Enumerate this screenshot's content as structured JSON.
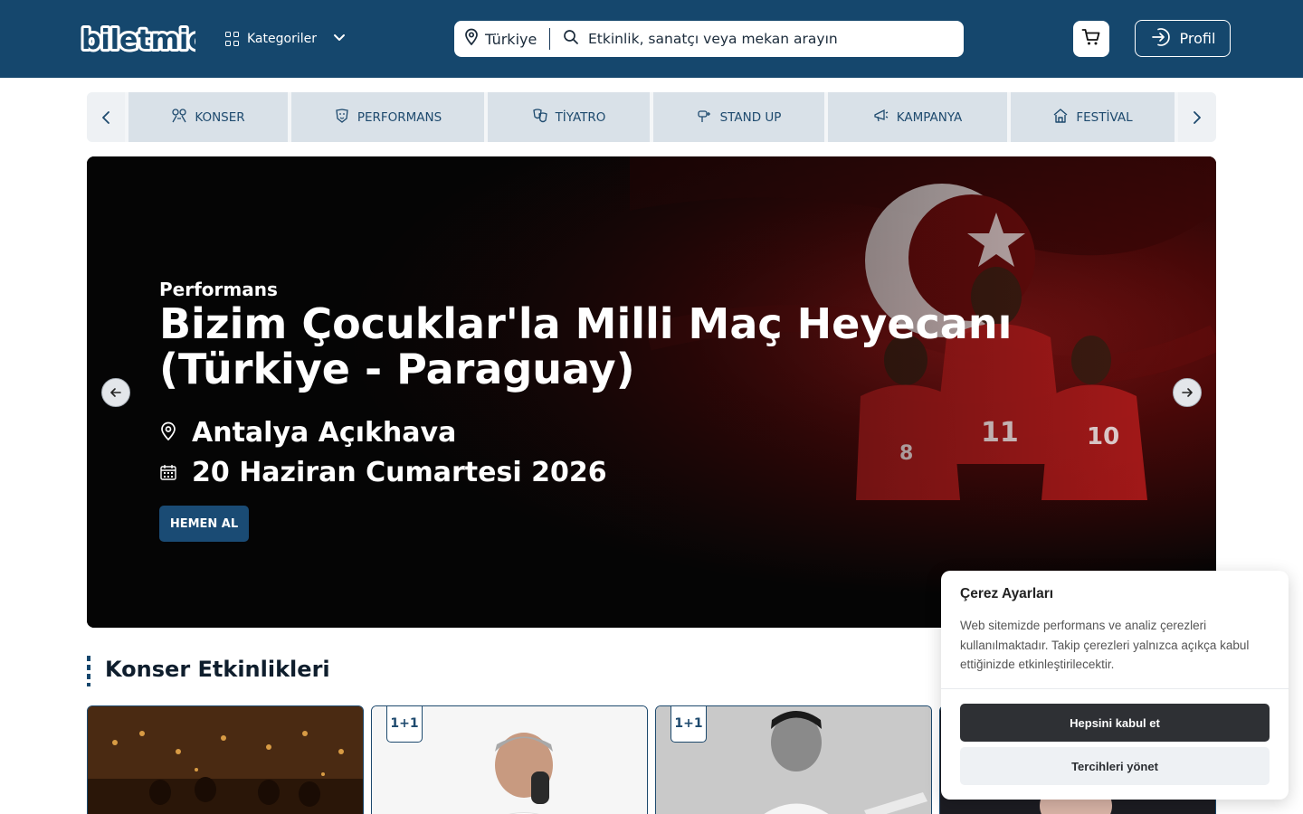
{
  "header": {
    "logo_text": "biletmio",
    "categories_label": "Kategoriler",
    "location": "Türkiye",
    "search_placeholder": "Etkinlik, sanatçı veya mekan arayın",
    "profile_label": "Profil",
    "icons": [
      "grid-icon",
      "chevron-down-icon",
      "map-pin-icon",
      "search-icon",
      "cart-icon",
      "login-icon"
    ]
  },
  "category_tabs": [
    {
      "label": "KONSER",
      "icon": "concert-icon"
    },
    {
      "label": "PERFORMANS",
      "icon": "performance-icon"
    },
    {
      "label": "TİYATRO",
      "icon": "theatre-masks-icon"
    },
    {
      "label": "STAND UP",
      "icon": "stand-up-icon"
    },
    {
      "label": "KAMPANYA",
      "icon": "megaphone-icon"
    },
    {
      "label": "FESTİVAL",
      "icon": "festival-icon"
    }
  ],
  "hero": {
    "category": "Performans",
    "title": "Bizim Çocuklar'la Milli Maç Heyecanı (Türkiye - Paraguay)",
    "venue": "Antalya Açıkhava",
    "date": "20 Haziran Cumartesi 2026",
    "cta": "HEMEN AL"
  },
  "section": {
    "title": "Konser Etkinlikleri",
    "cards": [
      {
        "badge": ""
      },
      {
        "badge": "1+1"
      },
      {
        "badge": "1+1"
      },
      {
        "badge": ""
      }
    ]
  },
  "cookie": {
    "title": "Çerez Ayarları",
    "text": "Web sitemizde performans ve analiz çerezleri kullanılmaktadır. Takip çerezleri yalnızca açıkça kabul ettiğinizde etkinleştirilecektir.",
    "accept": "Hepsini kabul et",
    "manage": "Tercihleri yönet"
  },
  "colors": {
    "header_bg": "#15476d",
    "tab_bg": "#d9e1e8",
    "cta_bg": "#1a4b74",
    "accept_bg": "#2e3034"
  }
}
